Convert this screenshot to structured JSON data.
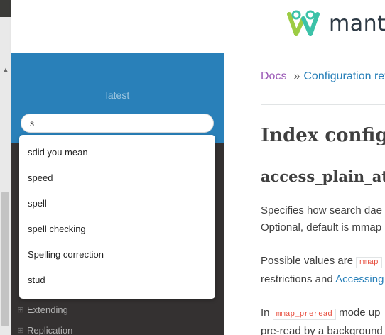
{
  "header": {
    "logo_text": "manti"
  },
  "sidebar": {
    "version": "latest",
    "search": {
      "value": "s"
    },
    "nav_items": [
      {
        "label": "Extending"
      },
      {
        "label": "Replication"
      }
    ]
  },
  "autocomplete": {
    "suggestions": [
      "sdid you mean",
      "speed",
      "spell",
      "spell checking",
      "Spelling correction",
      "stud"
    ]
  },
  "content": {
    "breadcrumb": {
      "home": "Docs",
      "separator": "»",
      "current": "Configuration ref"
    },
    "title": "Index configu",
    "section_title": "access_plain_at",
    "para1": {
      "line1": "Specifies how search dae",
      "line2": "Optional, default is mmap"
    },
    "para2": {
      "line1_text": "Possible values are",
      "line1_code": "mmap",
      "line2_text": "restrictions and",
      "line2_link": "Accessing"
    },
    "para3": {
      "line1_text": "In",
      "line1_code": "mmap_preread",
      "line1_rest": "mode up",
      "line2": "pre-read by a background"
    }
  },
  "colors": {
    "sidebar_accent": "#2980b9",
    "sidebar_bg": "#343131",
    "breadcrumb_home": "#9b59b6",
    "link": "#2980b9",
    "code": "#e74c3c"
  }
}
